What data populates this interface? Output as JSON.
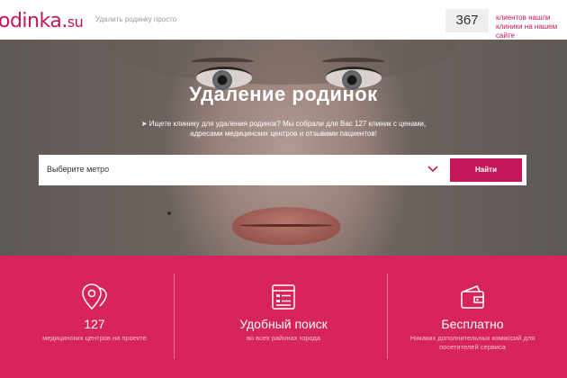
{
  "header": {
    "logo_main": "odinka.",
    "logo_tld": "su",
    "tagline": "Удалить родинку просто",
    "counter_value": "367",
    "counter_text": "клиентов нашли клиники на нашем сайте"
  },
  "hero": {
    "title": "Удаление родинок",
    "description": "➤ Ищете клинику для удаления родинок? Мы собрали для Вас 127 клиник с ценами, адресами медицинских центров и отзывами пациентов!",
    "metro_select_label": "Выберите метро",
    "find_button_label": "Найти"
  },
  "features": [
    {
      "title": "127",
      "subtitle": "медицинских центров на проекте",
      "icon": "map-pins-icon"
    },
    {
      "title": "Удобный поиск",
      "subtitle": "во всех районах города",
      "icon": "search-list-icon"
    },
    {
      "title": "Бесплатно",
      "subtitle": "Никаких дополнительных комиссий для посетителей сервиса",
      "icon": "wallet-icon"
    }
  ],
  "colors": {
    "brand": "#c2185b",
    "features_band": "#d7245c"
  }
}
